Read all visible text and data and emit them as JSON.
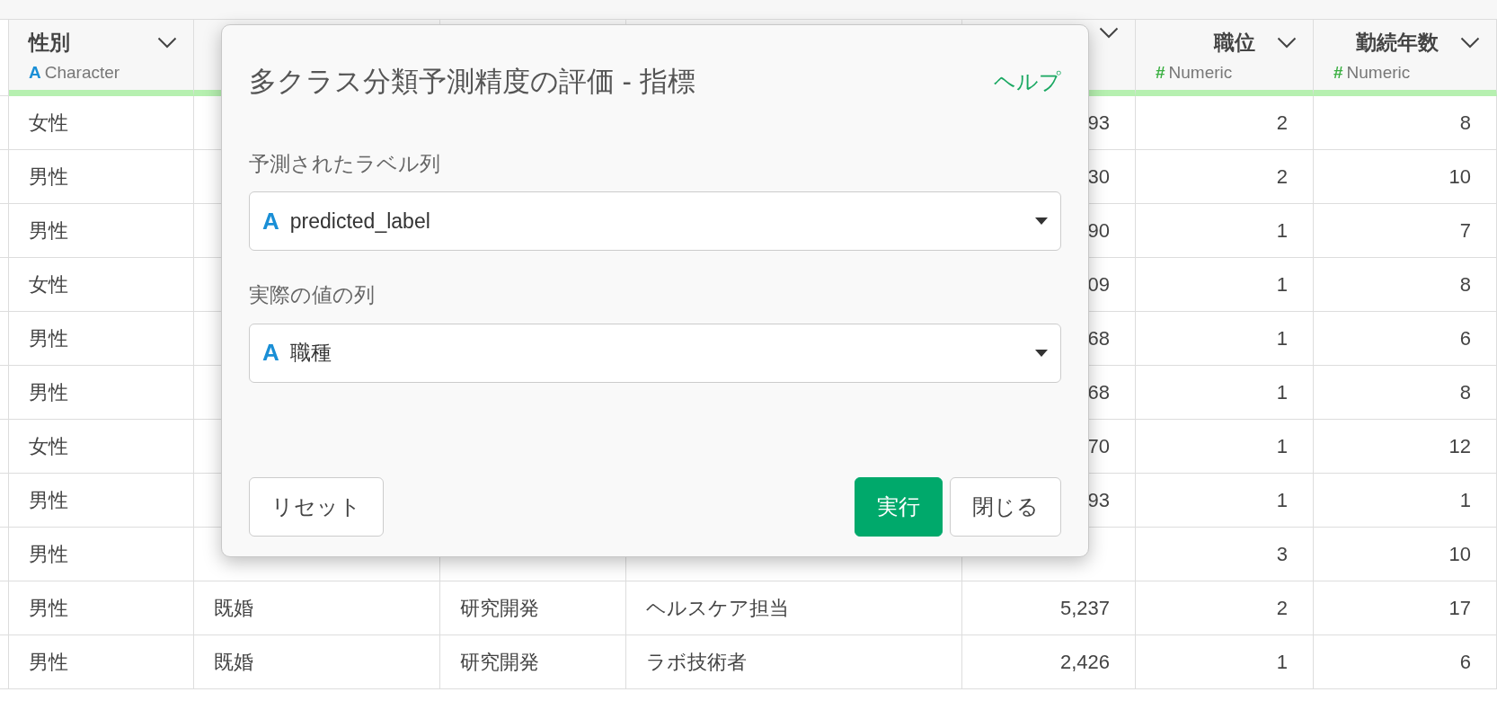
{
  "table": {
    "columns": [
      {
        "kind": "text",
        "name": "性別",
        "icon": "A",
        "type_label": "Character",
        "menu": true
      },
      {
        "kind": "text"
      },
      {
        "kind": "text"
      },
      {
        "kind": "text"
      },
      {
        "kind": "numeric",
        "menu": true
      },
      {
        "kind": "numeric",
        "name": "職位",
        "icon": "#",
        "type_label": "Numeric",
        "menu": true
      },
      {
        "kind": "numeric",
        "name": "勤続年数",
        "icon": "#",
        "type_label": "Numeric",
        "menu": true
      }
    ],
    "rows": [
      [
        "女性",
        null,
        null,
        null,
        "93",
        "2",
        "8"
      ],
      [
        "男性",
        null,
        null,
        null,
        "30",
        "2",
        "10"
      ],
      [
        "男性",
        null,
        null,
        null,
        "90",
        "1",
        "7"
      ],
      [
        "女性",
        null,
        null,
        null,
        "09",
        "1",
        "8"
      ],
      [
        "男性",
        null,
        null,
        null,
        "68",
        "1",
        "6"
      ],
      [
        "男性",
        null,
        null,
        null,
        "68",
        "1",
        "8"
      ],
      [
        "女性",
        null,
        null,
        null,
        "70",
        "1",
        "12"
      ],
      [
        "男性",
        null,
        null,
        null,
        "93",
        "1",
        "1"
      ],
      [
        "男性",
        null,
        null,
        null,
        null,
        "3",
        "10"
      ],
      [
        "男性",
        "既婚",
        "研究開発",
        "ヘルスケア担当",
        "5,237",
        "2",
        "17"
      ],
      [
        "男性",
        "既婚",
        "研究開発",
        "ラボ技術者",
        "2,426",
        "1",
        "6"
      ]
    ]
  },
  "dialog": {
    "title": "多クラス分類予測精度の評価 - 指標",
    "help": "ヘルプ",
    "fields": [
      {
        "label": "予測されたラベル列",
        "icon": "A",
        "value": "predicted_label"
      },
      {
        "label": "実際の値の列",
        "icon": "A",
        "value": "職種"
      }
    ],
    "footer_left": [
      {
        "label": "リセット"
      }
    ],
    "footer_right": [
      {
        "label": "実行",
        "kind": "primary"
      },
      {
        "label": "閉じる",
        "kind": "secondary"
      }
    ]
  }
}
